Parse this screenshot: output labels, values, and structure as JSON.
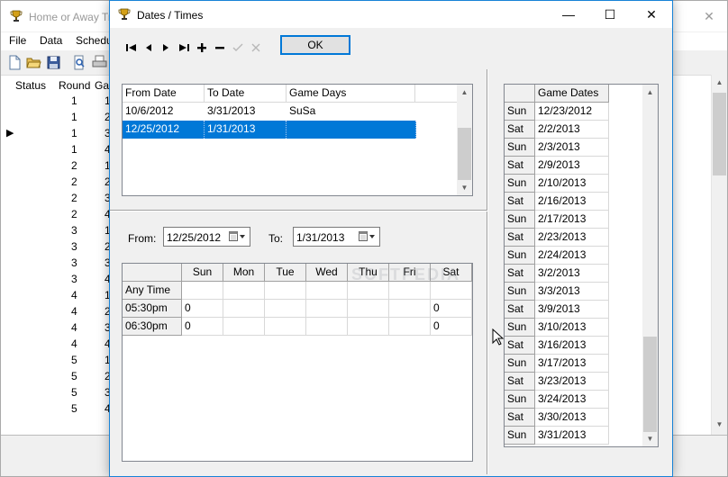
{
  "background_window": {
    "title": "Home or Away Tr",
    "close_glyph": "✕",
    "menu": [
      "File",
      "Data",
      "Schedu"
    ],
    "columns": [
      "Status",
      "Round",
      "Gar"
    ],
    "rows": [
      {
        "round": "1",
        "game": "1"
      },
      {
        "round": "1",
        "game": "2"
      },
      {
        "round": "1",
        "game": "3"
      },
      {
        "round": "1",
        "game": "4"
      },
      {
        "round": "2",
        "game": "1"
      },
      {
        "round": "2",
        "game": "2"
      },
      {
        "round": "2",
        "game": "3"
      },
      {
        "round": "2",
        "game": "4"
      },
      {
        "round": "3",
        "game": "1"
      },
      {
        "round": "3",
        "game": "2"
      },
      {
        "round": "3",
        "game": "3"
      },
      {
        "round": "3",
        "game": "4"
      },
      {
        "round": "4",
        "game": "1"
      },
      {
        "round": "4",
        "game": "2"
      },
      {
        "round": "4",
        "game": "3"
      },
      {
        "round": "4",
        "game": "4"
      },
      {
        "round": "5",
        "game": "1"
      },
      {
        "round": "5",
        "game": "2"
      },
      {
        "round": "5",
        "game": "3"
      },
      {
        "round": "5",
        "game": "4"
      }
    ],
    "current_row_marker": "▶"
  },
  "dialog": {
    "title": "Dates / Times",
    "minimize_glyph": "—",
    "maximize_glyph": "☐",
    "close_glyph": "✕",
    "ok_label": "OK",
    "date_ranges": {
      "columns": [
        "From Date",
        "To Date",
        "Game Days"
      ],
      "rows": [
        {
          "from": "10/6/2012",
          "to": "3/31/2013",
          "days": "SuSa",
          "selected": false
        },
        {
          "from": "12/25/2012",
          "to": "1/31/2013",
          "days": "",
          "selected": true
        }
      ]
    },
    "from_label": "From:",
    "from_value": "12/25/2012",
    "to_label": "To:",
    "to_value": "1/31/2013",
    "schedule": {
      "days": [
        "Sun",
        "Mon",
        "Tue",
        "Wed",
        "Thu",
        "Fri",
        "Sat"
      ],
      "rows": [
        {
          "time": "Any Time",
          "cells": [
            "",
            "",
            "",
            "",
            "",
            "",
            ""
          ]
        },
        {
          "time": "05:30pm",
          "cells": [
            "0",
            "",
            "",
            "",
            "",
            "",
            "0"
          ]
        },
        {
          "time": "06:30pm",
          "cells": [
            "0",
            "",
            "",
            "",
            "",
            "",
            "0"
          ]
        }
      ]
    },
    "game_dates": {
      "header": "Game Dates",
      "rows": [
        {
          "day": "Sun",
          "date": "12/23/2012"
        },
        {
          "day": "Sat",
          "date": "2/2/2013"
        },
        {
          "day": "Sun",
          "date": "2/3/2013"
        },
        {
          "day": "Sat",
          "date": "2/9/2013"
        },
        {
          "day": "Sun",
          "date": "2/10/2013"
        },
        {
          "day": "Sat",
          "date": "2/16/2013"
        },
        {
          "day": "Sun",
          "date": "2/17/2013"
        },
        {
          "day": "Sat",
          "date": "2/23/2013"
        },
        {
          "day": "Sun",
          "date": "2/24/2013"
        },
        {
          "day": "Sat",
          "date": "3/2/2013"
        },
        {
          "day": "Sun",
          "date": "3/3/2013"
        },
        {
          "day": "Sat",
          "date": "3/9/2013"
        },
        {
          "day": "Sun",
          "date": "3/10/2013"
        },
        {
          "day": "Sat",
          "date": "3/16/2013"
        },
        {
          "day": "Sun",
          "date": "3/17/2013"
        },
        {
          "day": "Sat",
          "date": "3/23/2013"
        },
        {
          "day": "Sun",
          "date": "3/24/2013"
        },
        {
          "day": "Sat",
          "date": "3/30/2013"
        },
        {
          "day": "Sun",
          "date": "3/31/2013"
        }
      ]
    },
    "watermark": "SOFTPEDIA",
    "colors": {
      "selection": "#0078d7",
      "focus_border": "#0078d7"
    }
  }
}
